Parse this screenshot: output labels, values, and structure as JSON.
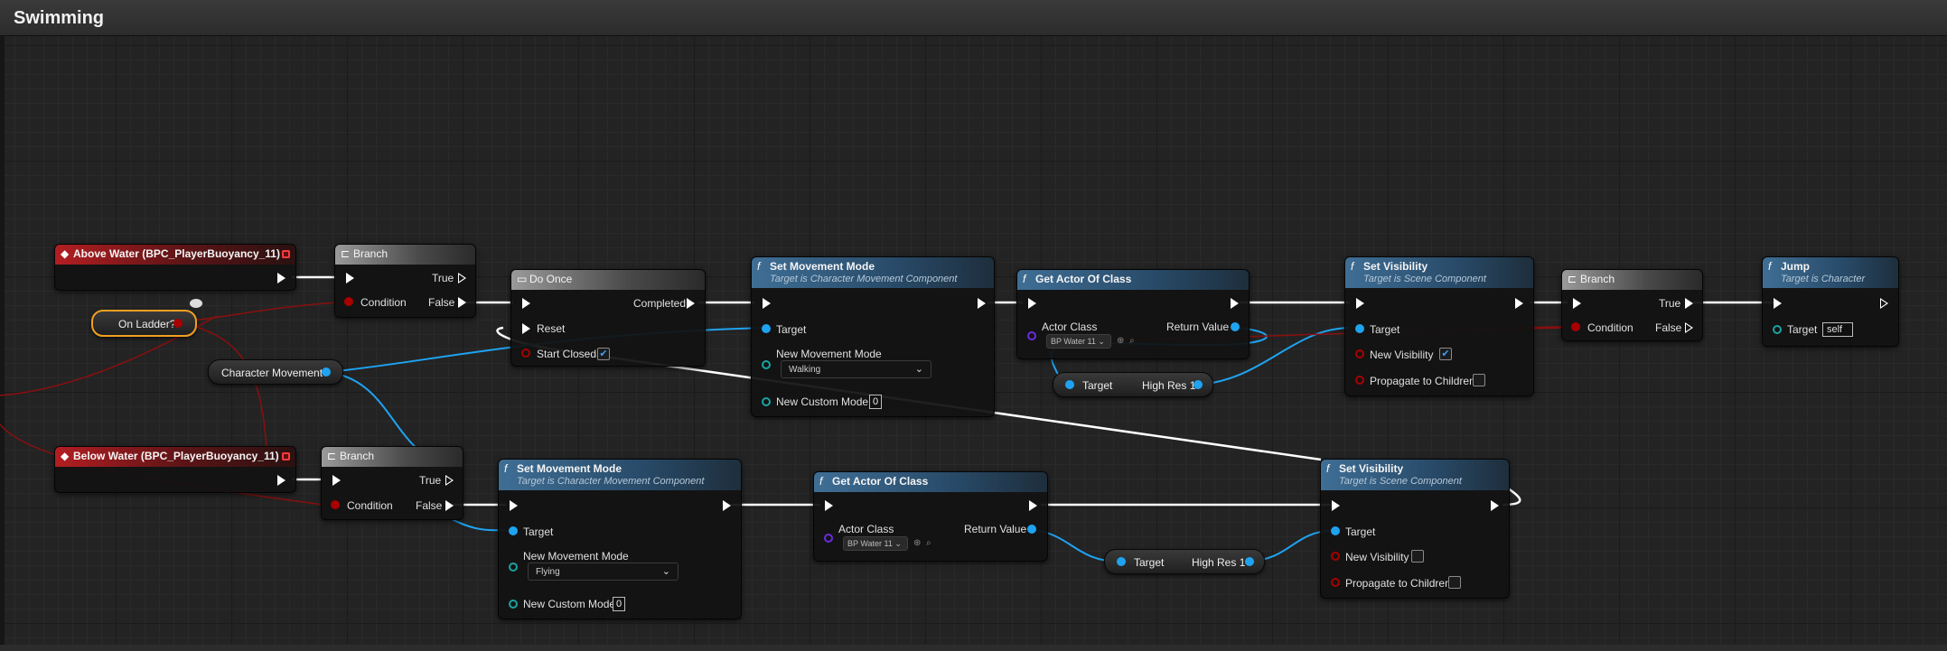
{
  "window": {
    "title": "Swimming"
  },
  "colors": {
    "exec": "#ffffff",
    "object_pin": "#1fa3f0",
    "bool_pin": "#a00000",
    "event_header": "#b31e22",
    "function_header": "#3f6e95",
    "selection": "#f0a020"
  },
  "icons": {
    "event": "event-diamond-icon",
    "branch": "branch-icon",
    "function": "function-f-icon",
    "macro": "macro-icon"
  },
  "nodes": {
    "above_water": {
      "title": "Above Water (BPC_PlayerBuoyancy_11)"
    },
    "below_water": {
      "title": "Below Water (BPC_PlayerBuoyancy_11)"
    },
    "branch1": {
      "title": "Branch",
      "condition": "Condition",
      "true": "True",
      "false": "False"
    },
    "branch2": {
      "title": "Branch",
      "condition": "Condition",
      "true": "True",
      "false": "False"
    },
    "branch3": {
      "title": "Branch",
      "condition": "Condition",
      "true": "True",
      "false": "False"
    },
    "on_ladder": {
      "label": "On Ladder?"
    },
    "char_movement": {
      "label": "Character Movement"
    },
    "do_once": {
      "title": "Do Once",
      "completed": "Completed",
      "reset": "Reset",
      "start_closed": "Start Closed",
      "start_closed_value": "✔"
    },
    "set_mode1": {
      "title": "Set Movement Mode",
      "subtitle": "Target is Character Movement Component",
      "target": "Target",
      "new_mode": "New Movement Mode",
      "mode_value": "Walking",
      "custom_mode": "New Custom Mode",
      "custom_value": "0"
    },
    "set_mode2": {
      "title": "Set Movement Mode",
      "subtitle": "Target is Character Movement Component",
      "target": "Target",
      "new_mode": "New Movement Mode",
      "mode_value": "Flying",
      "custom_mode": "New Custom Mode",
      "custom_value": "0"
    },
    "get_actor1": {
      "title": "Get Actor Of Class",
      "actor_class": "Actor Class",
      "class_value": "BP Water 11",
      "return_value": "Return Value"
    },
    "get_actor2": {
      "title": "Get Actor Of Class",
      "actor_class": "Actor Class",
      "class_value": "BP Water 11",
      "return_value": "Return Value"
    },
    "highres1": {
      "target": "Target",
      "label": "High Res 1"
    },
    "highres2": {
      "target": "Target",
      "label": "High Res 1"
    },
    "set_vis1": {
      "title": "Set Visibility",
      "subtitle": "Target is Scene Component",
      "target": "Target",
      "new_visibility": "New Visibility",
      "visibility_value": "✔",
      "propagate": "Propagate to Children"
    },
    "set_vis2": {
      "title": "Set Visibility",
      "subtitle": "Target is Scene Component",
      "target": "Target",
      "new_visibility": "New Visibility",
      "visibility_value": "",
      "propagate": "Propagate to Children"
    },
    "jump": {
      "title": "Jump",
      "subtitle": "Target is Character",
      "target": "Target",
      "target_value": "self"
    }
  }
}
